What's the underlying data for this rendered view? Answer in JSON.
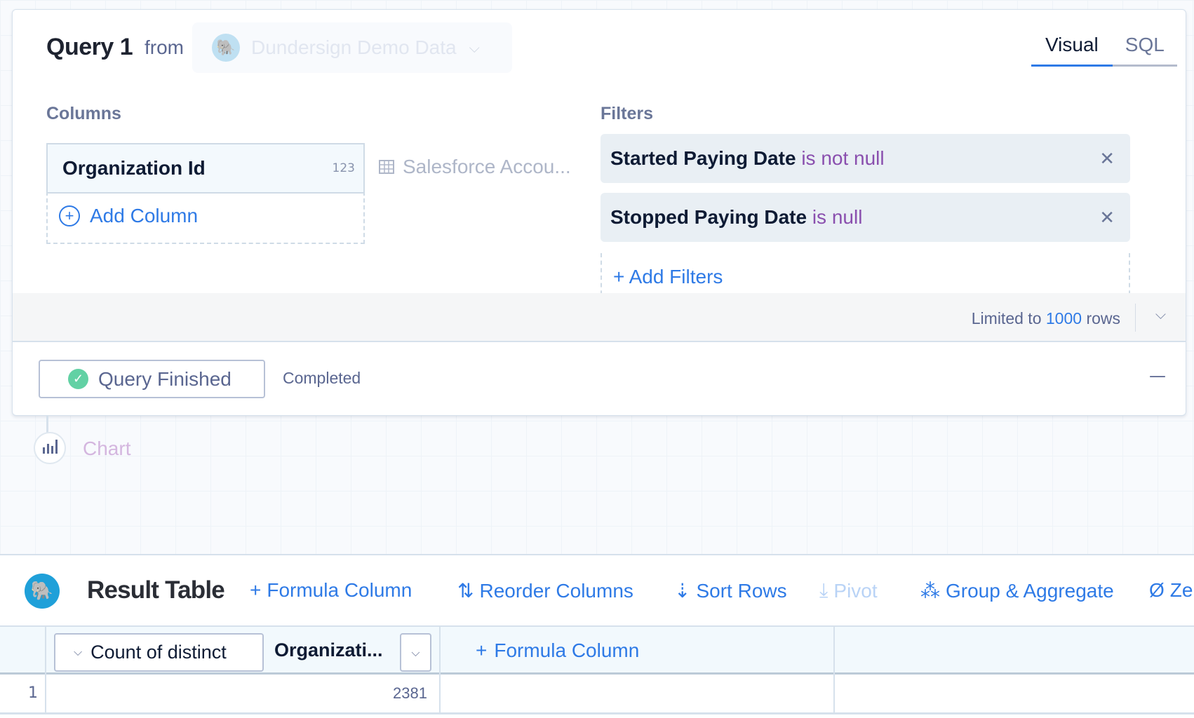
{
  "query": {
    "title": "Query 1",
    "from_label": "from",
    "database": {
      "name": "Dundersign Demo Data",
      "icon": "postgres-elephant-icon"
    },
    "tabs": [
      {
        "label": "Visual",
        "active": true
      },
      {
        "label": "SQL",
        "active": false
      }
    ],
    "columns_heading": "Columns",
    "columns": [
      {
        "name": "Organization Id",
        "type_badge": "123"
      }
    ],
    "add_column_label": "Add Column",
    "source_table": "Salesforce Accou...",
    "filters_heading": "Filters",
    "filters": [
      {
        "field": "Started Paying Date",
        "operator": "is not null"
      },
      {
        "field": "Stopped Paying Date",
        "operator": "is null"
      }
    ],
    "add_filters_label": "+ Add Filters",
    "limit": {
      "prefix": "Limited to",
      "value": "1000",
      "suffix": "rows"
    },
    "status": {
      "button_label": "Query Finished",
      "text": "Completed"
    },
    "collapse_symbol": "—"
  },
  "chart_step": {
    "label": "Chart"
  },
  "result": {
    "title": "Result Table",
    "toolbar": [
      {
        "label": "Formula Column",
        "icon": "+",
        "disabled": false
      },
      {
        "label": "Reorder Columns",
        "icon": "⇅",
        "disabled": false
      },
      {
        "label": "Sort Rows",
        "icon": "⇣",
        "disabled": false
      },
      {
        "label": "Pivot",
        "icon": "⤓",
        "disabled": true
      },
      {
        "label": "Group & Aggregate",
        "icon": "⁂",
        "disabled": false
      },
      {
        "label": "Ze",
        "icon": "Ø",
        "disabled": false
      }
    ],
    "columns": [
      {
        "aggregation": "Count of distinct",
        "name": "Organizati..."
      }
    ],
    "add_formula_label": "Formula Column",
    "rows": [
      {
        "index": "1",
        "values": [
          "2381"
        ]
      }
    ]
  },
  "colors": {
    "accent": "#2e7ae6",
    "operator": "#8a4fae",
    "success": "#62d1a4",
    "db_icon": "#1fa0d9"
  }
}
